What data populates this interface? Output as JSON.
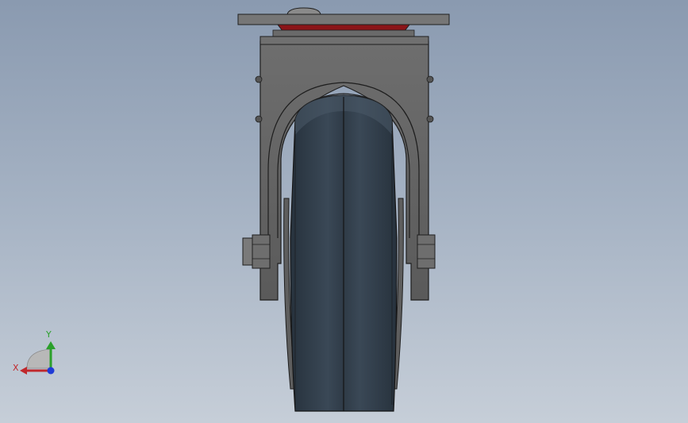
{
  "viewport": {
    "background_top": "#8a9ab0",
    "background_bottom": "#c6ced8"
  },
  "model": {
    "steel_color": "#6b6b6b",
    "steel_dark": "#3e3e3e",
    "tire_color": "#2f3b47",
    "tire_highlight": "#4a5968",
    "bearing_color": "#8b1418",
    "outline_color": "#1e1e1e"
  },
  "triad": {
    "x_label": "X",
    "y_label": "Y",
    "x_color": "#c0282c",
    "y_color": "#2ba02b",
    "z_color": "#1f3bd6"
  }
}
